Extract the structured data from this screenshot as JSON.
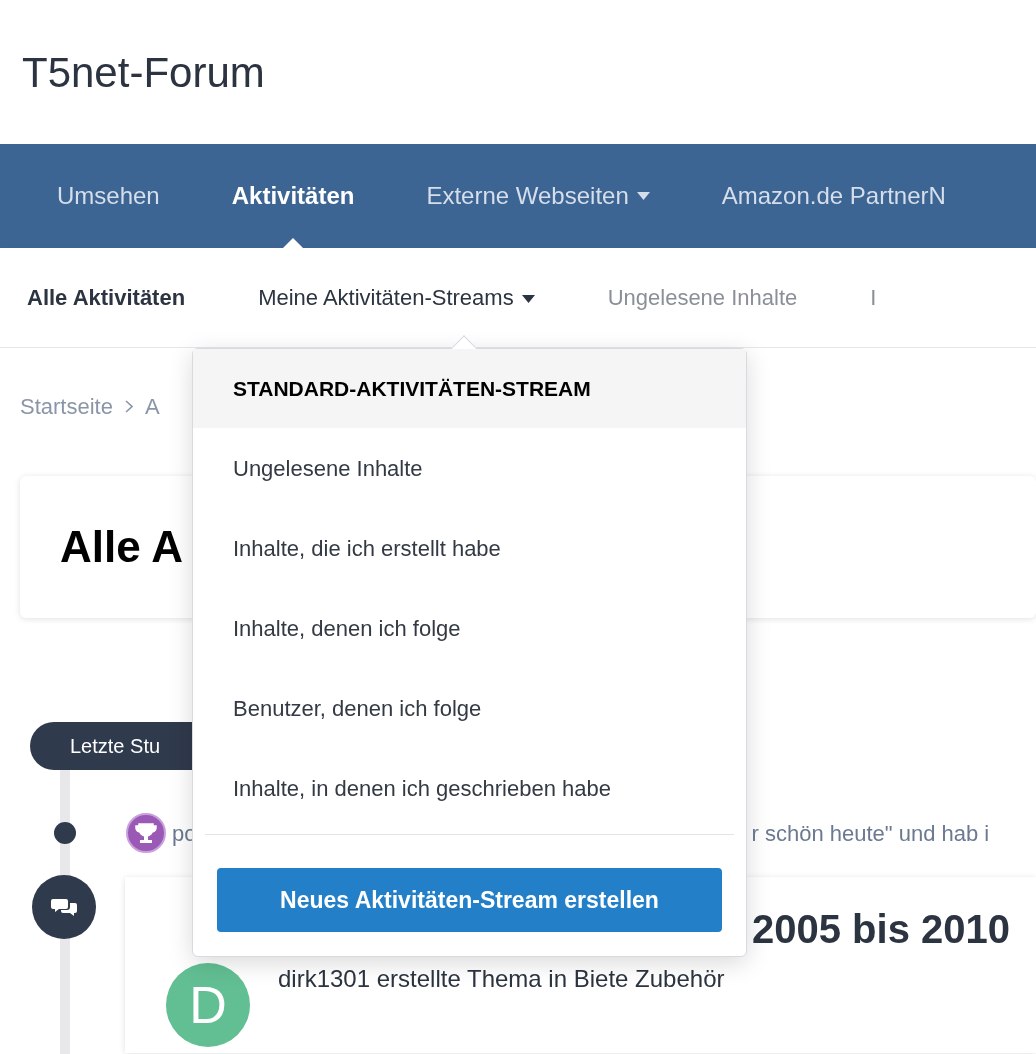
{
  "site_title": "T5net-Forum",
  "nav": [
    {
      "label": "Umsehen",
      "selected": false,
      "has_menu": false
    },
    {
      "label": "Aktivitäten",
      "selected": true,
      "has_menu": false
    },
    {
      "label": "Externe Webseiten",
      "selected": false,
      "has_menu": true
    },
    {
      "label": "Amazon.de PartnerN",
      "selected": false,
      "has_menu": false
    }
  ],
  "subnav": [
    {
      "label": "Alle Aktivitäten",
      "selected": true,
      "has_menu": false,
      "expanded": false
    },
    {
      "label": "Meine Aktivitäten-Streams",
      "selected": false,
      "has_menu": true,
      "expanded": true
    },
    {
      "label": "Ungelesene Inhalte",
      "selected": false,
      "has_menu": false,
      "expanded": false
    },
    {
      "label": "I",
      "selected": false,
      "has_menu": false,
      "expanded": false
    }
  ],
  "breadcrumb": [
    "Startseite",
    "A"
  ],
  "page_title": "Alle A",
  "timeline": {
    "period": "Letzte Stu",
    "activity": {
      "user": "po",
      "text": "r schön heute\" und hab i"
    },
    "topic": {
      "avatar_letter": "D",
      "title": "2005 bis 2010",
      "meta": "dirk1301 erstellte Thema in Biete Zubehör"
    }
  },
  "dropdown": {
    "header": "STANDARD-AKTIVITÄTEN-STREAM",
    "items": [
      "Ungelesene Inhalte",
      "Inhalte, die ich erstellt habe",
      "Inhalte, denen ich folge",
      "Benutzer, denen ich folge",
      "Inhalte, in denen ich geschrieben habe"
    ],
    "button": "Neues Aktivitäten-Stream erstellen"
  }
}
